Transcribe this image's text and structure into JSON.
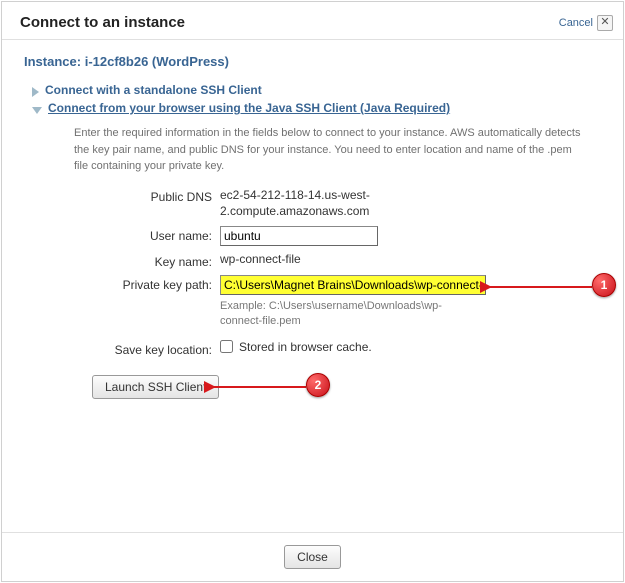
{
  "header": {
    "title": "Connect to an instance",
    "cancel_label": "Cancel"
  },
  "instance": {
    "prefix": "Instance:",
    "id_and_name": "i-12cf8b26 (WordPress)"
  },
  "tree": {
    "standalone": "Connect with a standalone SSH Client",
    "java_ssh": "Connect from your browser using the Java SSH Client (Java Required)"
  },
  "help_text": "Enter the required information in the fields below to connect to your instance. AWS automatically detects the key pair name, and public DNS for your instance. You need to enter location and name of the .pem file containing your private key.",
  "form": {
    "public_dns": {
      "label": "Public DNS",
      "value": "ec2-54-212-118-14.us-west-2.compute.amazonaws.com"
    },
    "user_name": {
      "label": "User name:",
      "value": "ubuntu"
    },
    "key_name": {
      "label": "Key name:",
      "value": "wp-connect-file"
    },
    "private_key_path": {
      "label": "Private key path:",
      "value": "C:\\Users\\Magnet Brains\\Downloads\\wp-connect-file.",
      "example": "Example: C:\\Users\\username\\Downloads\\wp-connect-file.pem"
    },
    "save_key": {
      "label": "Save key location:",
      "checkbox_label": "Stored in browser cache."
    }
  },
  "buttons": {
    "launch": "Launch SSH Client",
    "close": "Close"
  },
  "callouts": {
    "one": "1",
    "two": "2"
  }
}
